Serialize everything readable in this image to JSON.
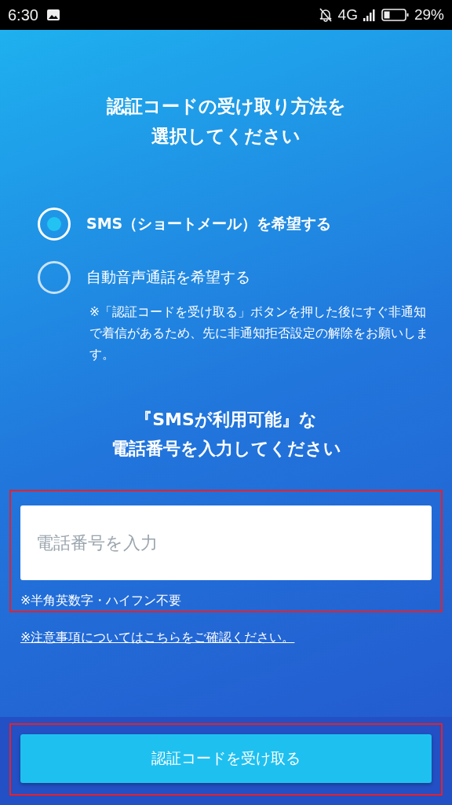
{
  "status_bar": {
    "time": "6:30",
    "network": "4G",
    "battery": "29%"
  },
  "title": [
    "認証コードの受け取り方法を",
    "選択してください"
  ],
  "options": [
    {
      "label": "SMS（ショートメール）を希望する",
      "selected": true
    },
    {
      "label": "自動音声通話を希望する",
      "selected": false,
      "note": "※「認証コードを受け取る」ボタンを押した後にすぐ非通知で着信があるため、先に非通知拒否設定の解除をお願いします。"
    }
  ],
  "phone_heading": [
    "『SMSが利用可能』な",
    "電話番号を入力してください"
  ],
  "phone_field": {
    "placeholder": "電話番号を入力",
    "hint": "※半角英数字・ハイフン不要",
    "highlighted": true
  },
  "notice_link": "※注意事項についてはこちらをご確認ください。",
  "submit_button": {
    "label": "認証コードを受け取る",
    "highlighted": true
  }
}
